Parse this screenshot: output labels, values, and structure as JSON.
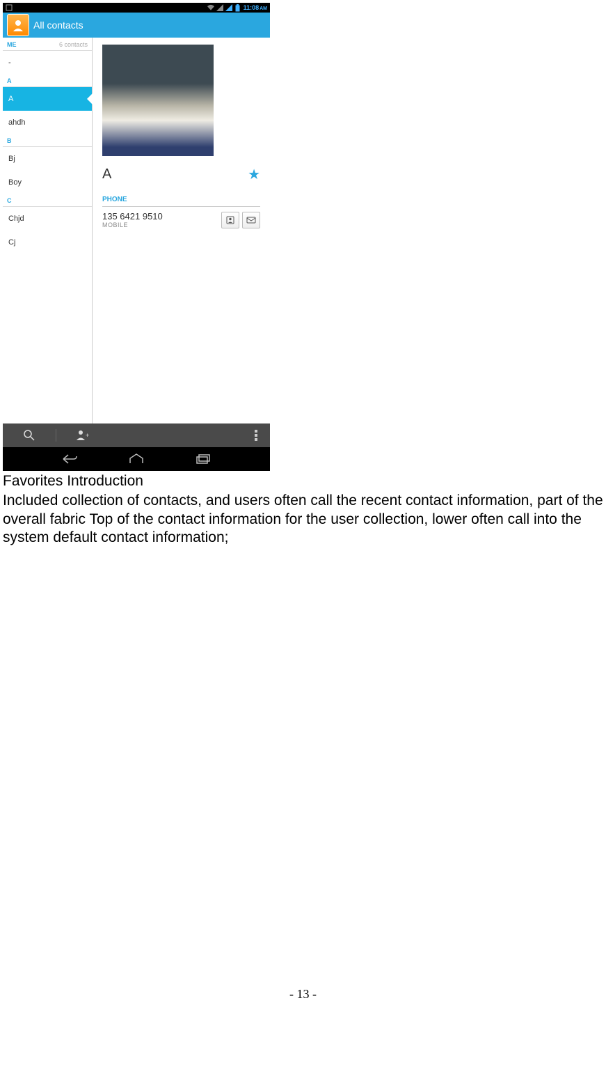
{
  "statusbar": {
    "time": "11:08",
    "ampm": "AM"
  },
  "appbar": {
    "title": "All contacts"
  },
  "sidebar": {
    "header_left": "ME",
    "header_right": "6 contacts",
    "items": [
      {
        "label": "-"
      },
      {
        "sep": "A"
      },
      {
        "label": "A",
        "selected": true
      },
      {
        "label": "ahdh"
      },
      {
        "sep": "B"
      },
      {
        "label": "Bj"
      },
      {
        "label": "Boy"
      },
      {
        "sep": "C"
      },
      {
        "label": "Chjd"
      },
      {
        "label": "Cj"
      }
    ]
  },
  "detail": {
    "name": "A",
    "section": "PHONE",
    "number": "135 6421 9510",
    "number_type": "MOBILE"
  },
  "text": {
    "heading": "Favorites Introduction",
    "paragraph": "Included collection of contacts, and users often call the recent contact information, part of the overall fabric Top of the contact information for the user collection, lower often call into the system default contact information;"
  },
  "footer": {
    "page": "- 13 -"
  }
}
